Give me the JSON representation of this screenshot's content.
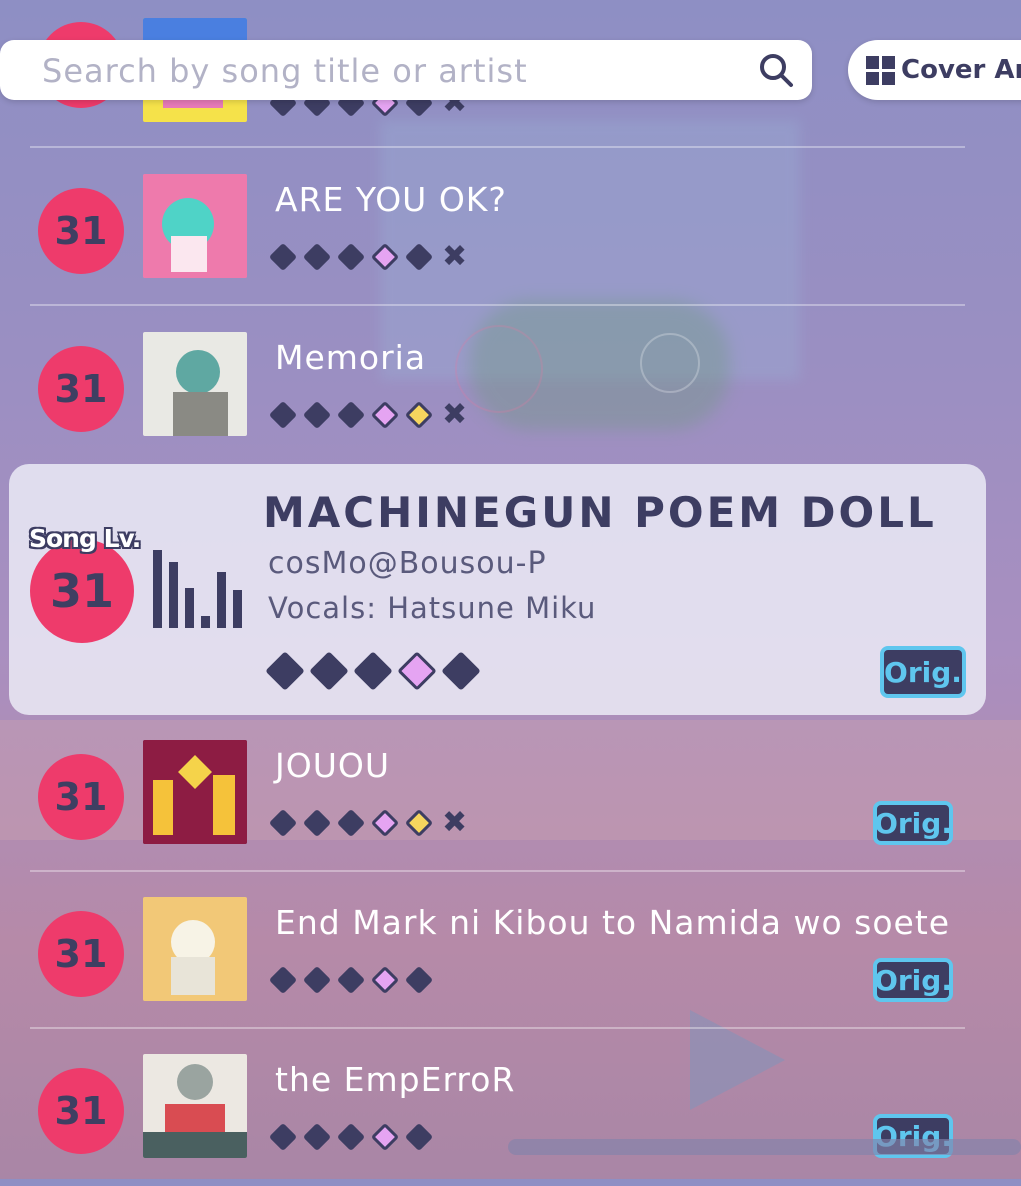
{
  "search": {
    "placeholder": "Search by song title or artist"
  },
  "cover_toggle": {
    "label": "Cover Ar"
  },
  "song_level_label": "Song Lv.",
  "rows": [
    {
      "level": "31",
      "title": "",
      "diffs": [
        "dark",
        "dark",
        "dark",
        "pink",
        "dark"
      ],
      "fc_mark": true,
      "orig": false
    },
    {
      "level": "31",
      "title": "ARE YOU OK?",
      "diffs": [
        "dark",
        "dark",
        "dark",
        "pink",
        "dark"
      ],
      "fc_mark": true,
      "orig": false
    },
    {
      "level": "31",
      "title": "Memoria",
      "diffs": [
        "dark",
        "dark",
        "dark",
        "pink",
        "gold"
      ],
      "fc_mark": true,
      "orig": false
    },
    {
      "level": "31",
      "title": "JOUOU",
      "diffs": [
        "dark",
        "dark",
        "dark",
        "pink",
        "gold"
      ],
      "fc_mark": true,
      "orig": true
    },
    {
      "level": "31",
      "title": "End Mark ni Kibou to Namida wo soete",
      "diffs": [
        "dark",
        "dark",
        "dark",
        "pink",
        "dark"
      ],
      "fc_mark": false,
      "orig": true
    },
    {
      "level": "31",
      "title": "the EmpErroR",
      "diffs": [
        "dark",
        "dark",
        "dark",
        "pink",
        "dark"
      ],
      "fc_mark": false,
      "orig": true
    }
  ],
  "selected": {
    "level": "31",
    "title": "MACHINEGUN POEM DOLL",
    "artist": "cosMo@Bousou-P",
    "vocals": "Vocals: Hatsune Miku",
    "diffs": [
      "dark",
      "dark",
      "dark",
      "pink",
      "dark"
    ],
    "orig_label": "Orig."
  },
  "orig_label": "Orig.",
  "colors": {
    "level_circle": "#ee3b6b",
    "dark": "#3d3d62",
    "orig_border": "#5fc6ee"
  }
}
